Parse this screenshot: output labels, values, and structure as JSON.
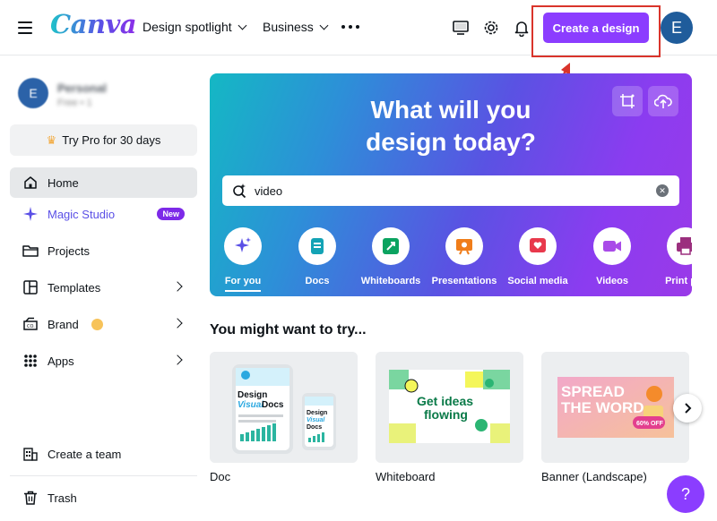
{
  "header": {
    "logo": "Canva",
    "nav": [
      "Design spotlight",
      "Business"
    ],
    "create_button": "Create a design",
    "avatar_initial": "E"
  },
  "sidebar": {
    "profile_initial": "E",
    "profile_name": "Personal",
    "profile_sub": "Free • 1",
    "try_pro": "Try Pro for 30 days",
    "items": [
      {
        "label": "Home"
      },
      {
        "label": "Magic Studio",
        "badge": "New"
      },
      {
        "label": "Projects"
      },
      {
        "label": "Templates"
      },
      {
        "label": "Brand"
      },
      {
        "label": "Apps"
      }
    ],
    "bottom": [
      {
        "label": "Create a team"
      },
      {
        "label": "Trash"
      }
    ]
  },
  "hero": {
    "title_line1": "What will you",
    "title_line2": "design today?",
    "search_value": "video",
    "categories": [
      {
        "label": "For you",
        "icon": "sparkle-icon",
        "color": "#5a4fe6"
      },
      {
        "label": "Docs",
        "icon": "doc-icon",
        "color": "#13a3b5"
      },
      {
        "label": "Whiteboards",
        "icon": "whiteboard-icon",
        "color": "#0ba360"
      },
      {
        "label": "Presentations",
        "icon": "presentation-icon",
        "color": "#f07d1a"
      },
      {
        "label": "Social media",
        "icon": "heart-icon",
        "color": "#e8394c"
      },
      {
        "label": "Videos",
        "icon": "video-icon",
        "color": "#a94be8"
      },
      {
        "label": "Print pro",
        "icon": "print-icon",
        "color": "#9b2f7e"
      }
    ]
  },
  "suggestions": {
    "title": "You might want to try...",
    "cards": [
      {
        "label": "Doc",
        "art_line1": "Design",
        "art_line2": "Visual",
        "art_line3": "Docs"
      },
      {
        "label": "Whiteboard",
        "art_line1": "Get ideas",
        "art_line2": "flowing"
      },
      {
        "label": "Banner (Landscape)",
        "art_line1": "SPREAD",
        "art_line2": "THE WORD",
        "art_badge": "60% OFF"
      }
    ]
  },
  "help": "?"
}
